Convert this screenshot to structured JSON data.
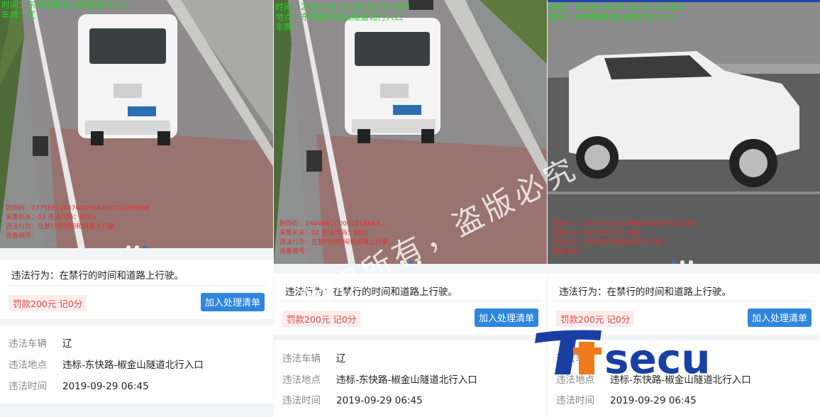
{
  "panels": [
    {
      "overlay_green": [
        "时间：东快路椒金山隧道北行入口",
        "车牌：辽"
      ],
      "overlay_red": [
        "防伪码：07758812F476C059A48EC02298906",
        "采集机关：02 违法代码：8801",
        "违法行为：在禁行的时间和道路上行驶。",
        "设备编号："
      ],
      "violation": "违法行为：在禁行的时间和道路上行驶。",
      "fine": "罚款200元 记0分",
      "add_button": "加入处理清单",
      "vehicle_label": "违法车辆",
      "vehicle_value": "辽",
      "location_label": "违法地点",
      "location_value": "违标-东快路-椒金山隧道北行入口",
      "time_label": "违法时间",
      "time_value": "2019-09-29 06:45"
    },
    {
      "overlay_green": [
        "时间：2019-09-29 06:45:51.863",
        "地点：东快路椒金山隧道北行入口",
        "车牌："
      ],
      "overlay_red": [
        "防伪码：2A0406CC0005B1B6E3...",
        "采集机关：02 违法代码：8801",
        "违法行为：在禁行的时间和道路上行驶。",
        "设备编号："
      ],
      "violation": "违法行为：在禁行的时间和道路上行驶。",
      "fine": "罚款200元 记0分",
      "add_button": "加入处理清单",
      "vehicle_label": "违法车辆",
      "vehicle_value": "辽",
      "location_label": "违法地点",
      "location_value": "违标-东快路-椒金山隧道北行入口",
      "time_label": "违法时间",
      "time_value": "2019-09-29 06:45"
    },
    {
      "overlay_green": [
        "时间：2019-09-29 06:45:51.863",
        "地点：东快路椒金山隧道北行入口"
      ],
      "overlay_red": [
        "防伪码：19CF3F0687818B82E2540FF2132EE",
        "采集机关：02 违法代码：8801",
        "违法行为：在禁行的时间和道路上行驶。",
        "设备编号："
      ],
      "violation": "违法行为：在禁行的时间和道路上行驶。",
      "fine": "罚款200元 记0分",
      "add_button": "加入处理清单",
      "vehicle_label": "违法车辆",
      "vehicle_value": "",
      "location_label": "违法地点",
      "location_value": "违标-东快路-椒金山隧道北行入口",
      "time_label": "违法时间",
      "time_value": "2019-09-29 06:45"
    }
  ],
  "watermark": "版权所有，盗版必究",
  "logo_text": "Ttsecu",
  "colors": {
    "accent": "#2f86de",
    "fine_text": "#e04848",
    "fine_bg": "#fdecec",
    "logo_blue": "#1a3fa3",
    "logo_orange": "#f07a1a"
  }
}
